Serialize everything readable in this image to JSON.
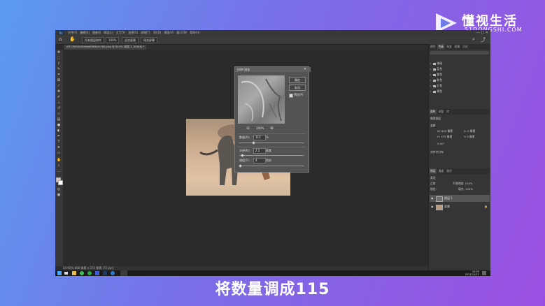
{
  "watermark": {
    "title": "懂视生活",
    "sub": "51DONGSHI.COM"
  },
  "caption": "将数量调成115",
  "menu": [
    "文件(F)",
    "编辑(E)",
    "图像(I)",
    "图层(L)",
    "文字(Y)",
    "选择(S)",
    "滤镜(T)",
    "3D(D)",
    "视图(V)",
    "窗口(W)",
    "帮助(H)"
  ],
  "options": {
    "sample": "所有图层取样",
    "zoom": "100%",
    "fit": "适合屏幕",
    "fill": "填充屏幕"
  },
  "document_tab": "ef717b5d015d9ea66f69e4c7b0.jpeg @ 50.9% (图层 1, RGB/8) *",
  "dialog": {
    "title": "USM 锐化",
    "ok": "确定",
    "cancel": "取消",
    "preview_label": "预览(P)",
    "zoom": "100%",
    "amount_label": "数量(A):",
    "amount_value": "115",
    "amount_unit": "%",
    "amount_fraction": 0.22,
    "radius_label": "半径(R):",
    "radius_value": "2.5",
    "radius_unit": "像素",
    "radius_fraction": 0.05,
    "threshold_label": "阈值(T):",
    "threshold_value": "4",
    "threshold_unit": "色阶",
    "threshold_fraction": 0.02
  },
  "status": "50.91%   800 像素 x 573 像素 (72 ppi)",
  "panels": {
    "top_tabs": [
      "颜色",
      "色板",
      "渐变",
      "图案",
      "历史"
    ],
    "swatch_folders": [
      "基础",
      "蓝色",
      "紫色",
      "粉色",
      "红色",
      "褐色"
    ],
    "props_tabs": [
      "属性",
      "调整",
      "库"
    ],
    "props_layer": "像素图层",
    "transform_label": "变换",
    "w": "W: 800 像素",
    "h": "H: 573 像素",
    "x": "X: 0 像素",
    "y": "Y: 0 像素",
    "angle": "0.00°",
    "align_label": "对齐并分布",
    "layer_tabs": [
      "图层",
      "通道",
      "路径"
    ],
    "kind": "类型",
    "mode": "正常",
    "opacity": "不透明度: 100%",
    "lock": "锁定:",
    "fill": "填充: 100%",
    "layers": [
      "图层 1",
      "背景"
    ]
  },
  "taskbar": {
    "time": "10:59",
    "date": "2021/11/12"
  }
}
